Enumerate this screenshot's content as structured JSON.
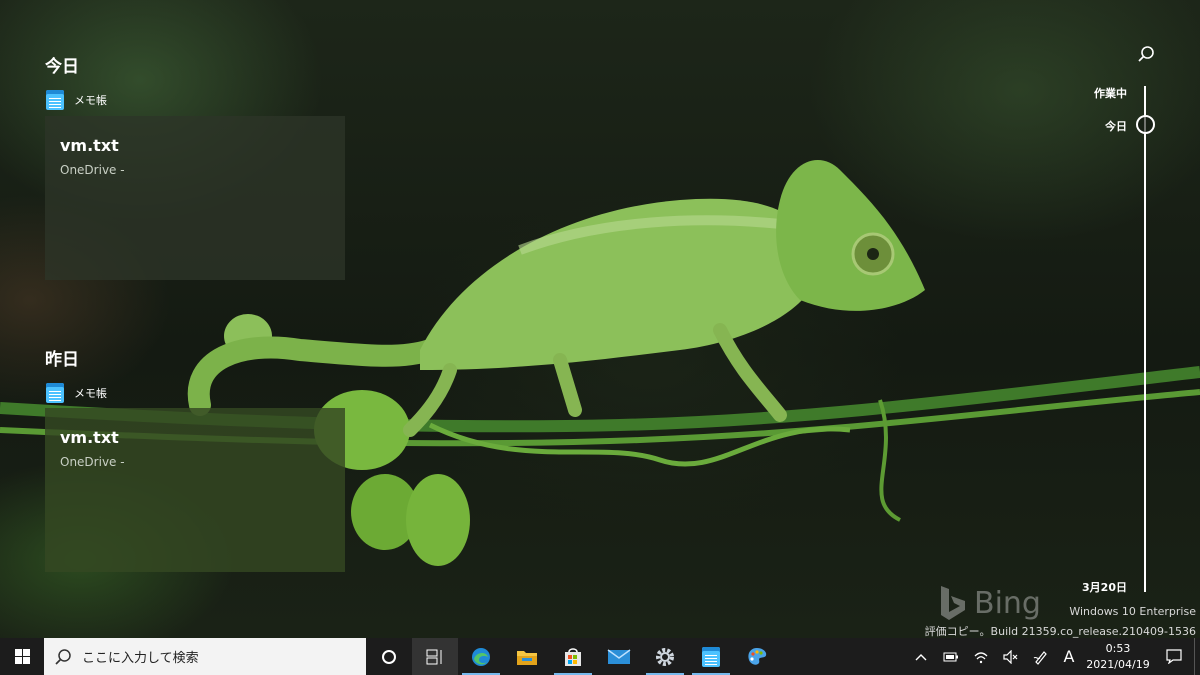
{
  "timeline": {
    "groups": [
      {
        "heading": "今日",
        "app": "メモ帳",
        "card": {
          "title": "vm.txt",
          "subtitle": "OneDrive -"
        }
      },
      {
        "heading": "昨日",
        "app": "メモ帳",
        "card": {
          "title": "vm.txt",
          "subtitle": "OneDrive -"
        }
      }
    ],
    "scrubber": {
      "top_label": "作業中",
      "current_label": "今日",
      "bottom_label": "3月20日"
    }
  },
  "watermark": {
    "brand": "Bing",
    "edition": "Windows 10 Enterprise",
    "build": "評価コピー。Build 21359.co_release.210409-1536"
  },
  "taskbar": {
    "search_placeholder": "ここに入力して検索",
    "apps": [
      "edge-icon",
      "file-explorer-icon",
      "store-icon",
      "mail-icon",
      "settings-icon",
      "notepad-icon",
      "paint-icon"
    ],
    "ime": "A",
    "time": "0:53",
    "date": "2021/04/19"
  },
  "colors": {
    "taskbar_bg": "#1c1c1c",
    "accent": "#76b9ed",
    "notepad_blue": "#4cc2ff"
  }
}
